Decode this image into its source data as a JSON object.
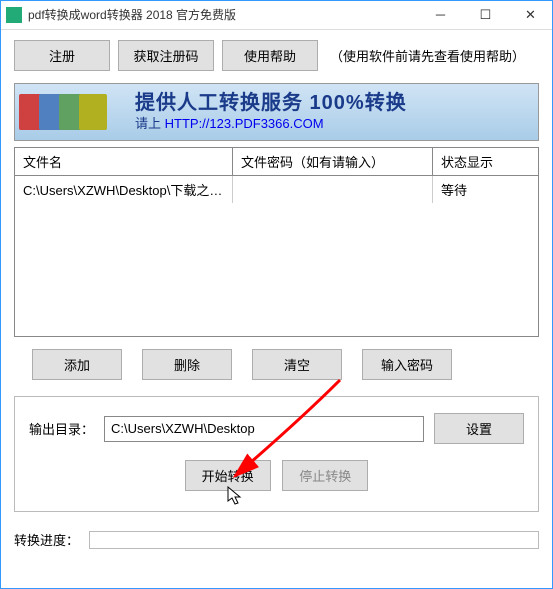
{
  "window": {
    "title": "pdf转换成word转换器 2018 官方免费版"
  },
  "topbar": {
    "register": "注册",
    "get_code": "获取注册码",
    "help": "使用帮助",
    "hint": "（使用软件前请先查看使用帮助）"
  },
  "banner": {
    "line1": "提供人工转换服务 100%转换",
    "line2_prefix": "请上 ",
    "line2_url": "HTTP://123.PDF3366.COM"
  },
  "list": {
    "headers": {
      "filename": "文件名",
      "password": "文件密码（如有请输入）",
      "status": "状态显示"
    },
    "rows": [
      {
        "filename": "C:\\Users\\XZWH\\Desktop\\下载之家....",
        "password": "",
        "status": "等待"
      }
    ]
  },
  "actions": {
    "add": "添加",
    "delete": "删除",
    "clear": "清空",
    "enter_pwd": "输入密码"
  },
  "output": {
    "label": "输出目录：",
    "path": "C:\\Users\\XZWH\\Desktop",
    "settings": "设置",
    "start": "开始转换",
    "stop": "停止转换"
  },
  "progress": {
    "label": "转换进度："
  }
}
